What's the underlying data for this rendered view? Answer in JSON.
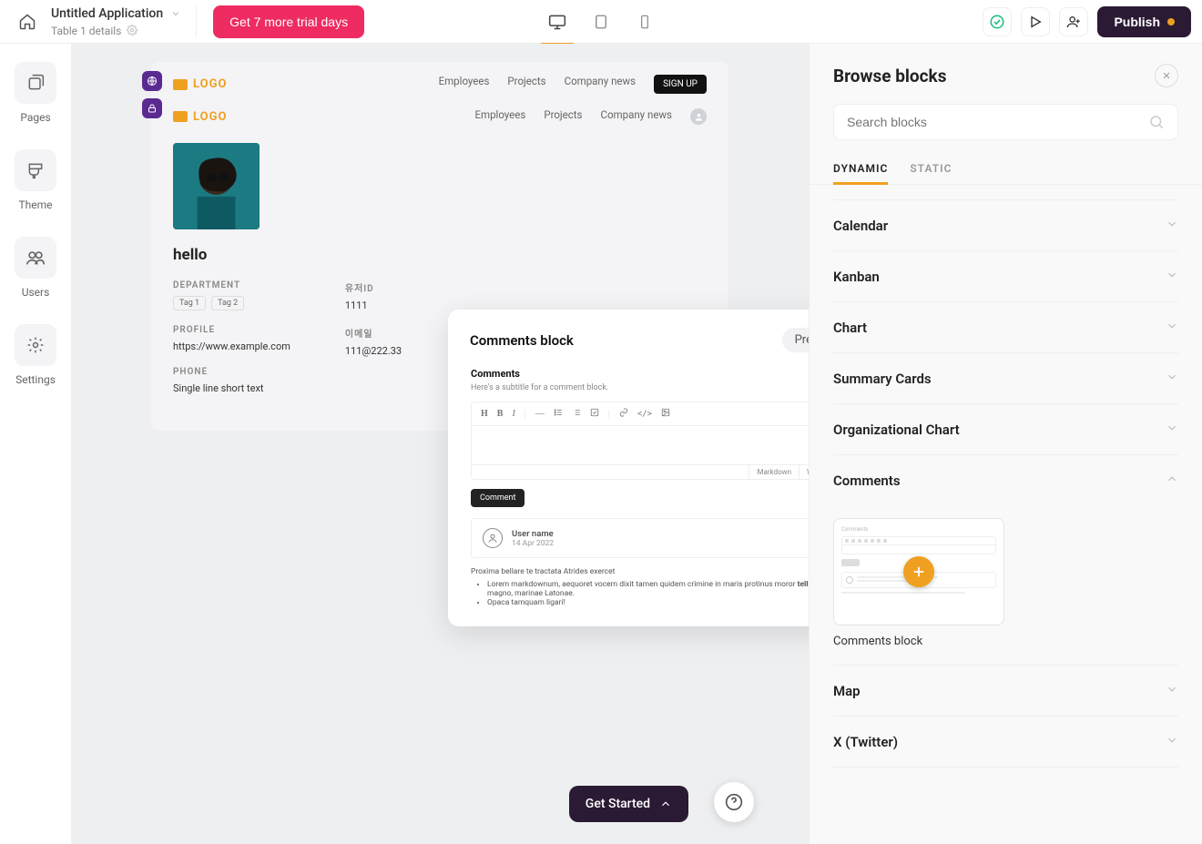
{
  "header": {
    "app_name": "Untitled Application",
    "subtitle": "Table 1 details",
    "trial_label": "Get 7 more trial days",
    "publish_label": "Publish"
  },
  "leftrail": {
    "pages": "Pages",
    "theme": "Theme",
    "users": "Users",
    "settings": "Settings"
  },
  "site": {
    "logo_text": "LOGO",
    "nav1": {
      "employees": "Employees",
      "projects": "Projects",
      "news": "Company news",
      "signup": "SIGN UP"
    },
    "nav2": {
      "employees": "Employees",
      "projects": "Projects",
      "news": "Company news"
    }
  },
  "profile": {
    "name": "hello",
    "dept_label": "DEPARTMENT",
    "tags": {
      "t1": "Tag 1",
      "t2": "Tag 2"
    },
    "userid_label": "유저ID",
    "userid_value": "1111",
    "profile_label": "PROFILE",
    "profile_value": "https://www.example.com",
    "email_label": "이메일",
    "email_value": "111@222.33",
    "phone_label": "PHONE",
    "phone_value": "Single line short text"
  },
  "popover": {
    "title": "Comments block",
    "preview": "Preview",
    "section_title": "Comments",
    "subtitle": "Here's a subtitle for a comment block.",
    "toolbar": {
      "h": "H",
      "b": "B",
      "i": "I",
      "dash": "—",
      "ul": "≣",
      "ol": "≣",
      "check": "☑",
      "link": "🔗",
      "code": "</>",
      "img": "▢"
    },
    "tabs": {
      "md": "Markdown",
      "wys": "WYSIWYG"
    },
    "comment_btn": "Comment",
    "user_name": "User name",
    "user_date": "14 Apr 2022",
    "lorem_lead": "Proxima bellare te tractata Atrides exercet",
    "lorem_li1_a": "Lorem markdownum, aequoret vocem dixit tamen quidem crimine in maris protinus moror ",
    "lorem_li1_b": "telluris",
    "lorem_li1_c": " magno, marinae Latonae.",
    "lorem_li2": "Opaca tamquam ligari!"
  },
  "rightpanel": {
    "title": "Browse blocks",
    "search_placeholder": "Search blocks",
    "tabs": {
      "dynamic": "DYNAMIC",
      "static": "STATIC"
    },
    "categories": {
      "calendar": "Calendar",
      "kanban": "Kanban",
      "chart": "Chart",
      "summary": "Summary Cards",
      "org": "Organizational Chart",
      "comments": "Comments",
      "map": "Map",
      "twitter": "X (Twitter)"
    },
    "comments_caption": "Comments block",
    "mini_heading": "Comments"
  },
  "footer": {
    "get_started": "Get Started"
  }
}
